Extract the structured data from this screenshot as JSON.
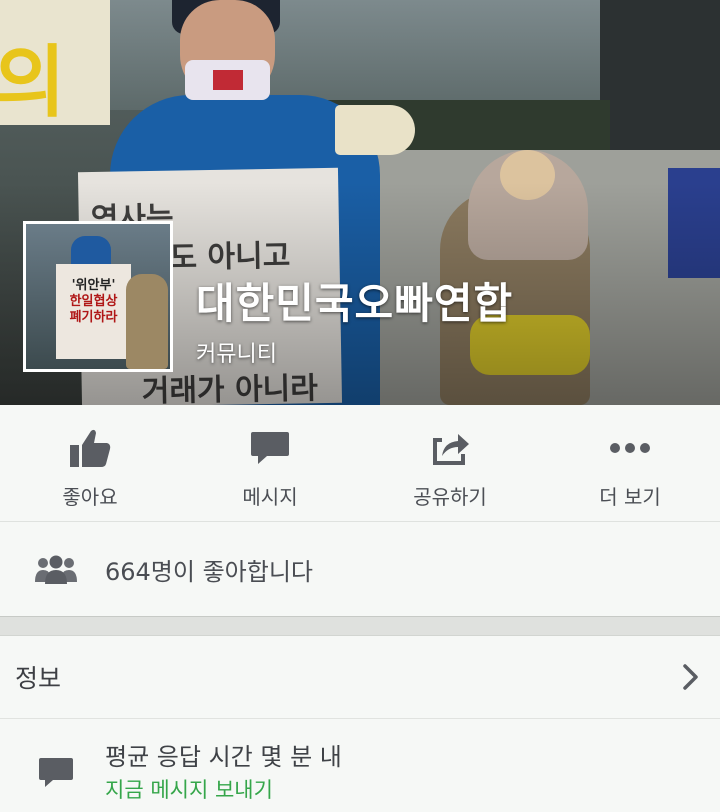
{
  "page": {
    "name": "대한민국오빠연합",
    "category": "커뮤니티"
  },
  "actions": [
    {
      "label": "좋아요",
      "icon": "thumbs-up-icon"
    },
    {
      "label": "메시지",
      "icon": "message-icon"
    },
    {
      "label": "공유하기",
      "icon": "share-icon"
    },
    {
      "label": "더 보기",
      "icon": "more-icon"
    }
  ],
  "likes": {
    "text": "664명이 좋아합니다",
    "icon": "people-icon"
  },
  "info": {
    "title": "정보",
    "icon": "chevron-right-icon"
  },
  "response": {
    "text": "평균 응답 시간 몇 분 내",
    "cta": "지금 메시지 보내기",
    "icon": "message-icon"
  },
  "colors": {
    "accent": "#35a64a",
    "icon_gray": "#5a5d63",
    "text_dark": "#3f4247"
  }
}
